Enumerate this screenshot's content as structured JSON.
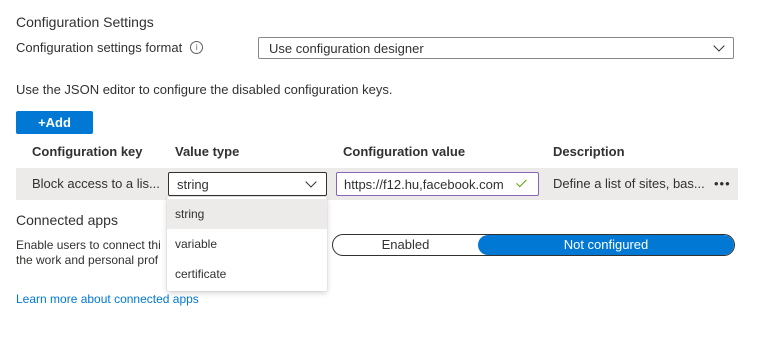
{
  "section": {
    "title": "Configuration Settings"
  },
  "format": {
    "label": "Configuration settings format",
    "info_icon": "info-icon",
    "selected": "Use configuration designer"
  },
  "helper_text": "Use the JSON editor to configure the disabled configuration keys.",
  "add_button": {
    "label": "+Add"
  },
  "table": {
    "columns": [
      "Configuration key",
      "Value type",
      "Configuration value",
      "Description"
    ],
    "row": {
      "key": "Block access to a lis...",
      "value_type": "string",
      "value": "https://f12.hu,facebook.com",
      "description": "Define a list of sites, bas...",
      "more": "•••"
    }
  },
  "value_type_menu": {
    "options": [
      {
        "label": "string",
        "selected": true
      },
      {
        "label": "variable",
        "selected": false
      },
      {
        "label": "certificate",
        "selected": false
      }
    ]
  },
  "connected_apps": {
    "title": "Connected apps",
    "description_line1": "Enable users to connect thi",
    "description_line2": "the work and personal prof",
    "toggle": {
      "option_1": "Enabled",
      "option_2": "Not configured",
      "selected": "Not configured"
    },
    "learn_more": "Learn more about connected apps"
  },
  "colors": {
    "accent": "#0078d4",
    "row_bg": "#edebe9",
    "focus_border": "#8764b8",
    "check": "#57a300"
  }
}
